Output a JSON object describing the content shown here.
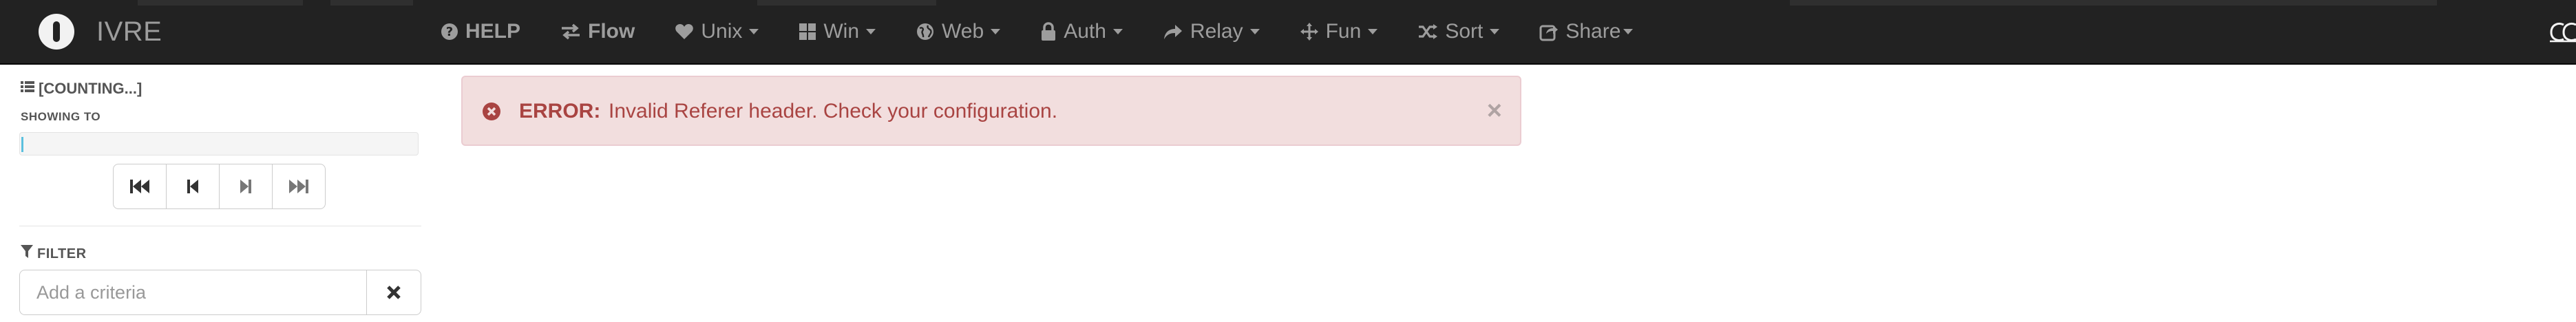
{
  "app": {
    "name": "IVRE"
  },
  "nav": {
    "items": [
      {
        "label": "HELP",
        "icon": "question-circle-icon",
        "dropdown": false
      },
      {
        "label": "Flow",
        "icon": "random-arrows-icon",
        "dropdown": false
      },
      {
        "label": "Unix",
        "icon": "heart-icon",
        "dropdown": true
      },
      {
        "label": "Win",
        "icon": "windows-icon",
        "dropdown": true
      },
      {
        "label": "Web",
        "icon": "globe-icon",
        "dropdown": true
      },
      {
        "label": "Auth",
        "icon": "lock-icon",
        "dropdown": true
      },
      {
        "label": "Relay",
        "icon": "share-arrow-icon",
        "dropdown": true
      },
      {
        "label": "Fun",
        "icon": "move-icon",
        "dropdown": true
      },
      {
        "label": "Sort",
        "icon": "shuffle-icon",
        "dropdown": true
      },
      {
        "label": "Share",
        "icon": "external-share-icon",
        "dropdown": true
      }
    ]
  },
  "sidebar": {
    "count_text": "[COUNTING...]",
    "showing_label": "SHOWING TO",
    "filter_label": "FILTER",
    "filter_placeholder": "Add a criteria"
  },
  "alert": {
    "title": "ERROR:",
    "message": "Invalid Referer header. Check your configuration.",
    "close": "×"
  },
  "colors": {
    "navbar": "#222222",
    "nav_text": "#9d9d9d",
    "alert_bg": "#f2dede",
    "alert_text": "#a94442",
    "progress_fill": "#5bc0de"
  }
}
